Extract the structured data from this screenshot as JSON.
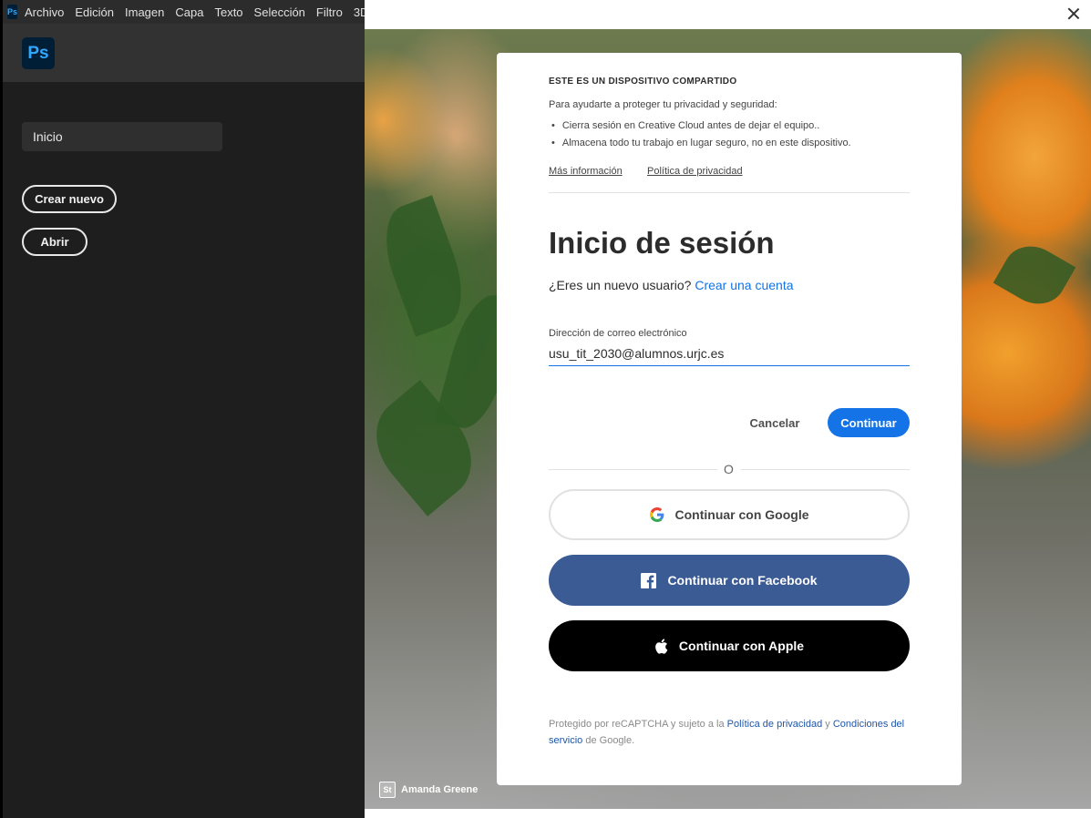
{
  "app": {
    "menu": [
      "Archivo",
      "Edición",
      "Imagen",
      "Capa",
      "Texto",
      "Selección",
      "Filtro",
      "3D"
    ],
    "mini_logo": "Ps",
    "logo": "Ps",
    "nav_home": "Inicio",
    "create_new": "Crear nuevo",
    "open": "Abrir"
  },
  "dialog": {
    "shared_device": {
      "title": "ESTE ES UN DISPOSITIVO COMPARTIDO",
      "intro": "Para ayudarte a proteger tu privacidad y seguridad:",
      "bullets": [
        "Cierra sesión en Creative Cloud antes de dejar el equipo..",
        "Almacena todo tu trabajo en lugar seguro, no en este dispositivo."
      ],
      "more_info": "Más información",
      "privacy_policy": "Política de privacidad"
    },
    "signin_title": "Inicio de sesión",
    "new_user_prompt": "¿Eres un nuevo usuario?",
    "create_account": "Crear una cuenta",
    "email_label": "Dirección de correo electrónico",
    "email_value": "usu_tit_2030@alumnos.urjc.es",
    "cancel": "Cancelar",
    "continue": "Continuar",
    "or": "O",
    "google": "Continuar con Google",
    "facebook": "Continuar con Facebook",
    "apple": "Continuar con Apple",
    "recaptcha": {
      "pre": "Protegido por reCAPTCHA y sujeto a la ",
      "privacy": "Política de privacidad",
      "and": " y ",
      "terms": "Condiciones del servicio",
      "post": " de Google."
    },
    "stock_badge": "St",
    "stock_credit": "Amanda Greene"
  },
  "colors": {
    "accent": "#1473e6",
    "facebook": "#3b5b95",
    "ps_blue": "#31a8ff"
  }
}
